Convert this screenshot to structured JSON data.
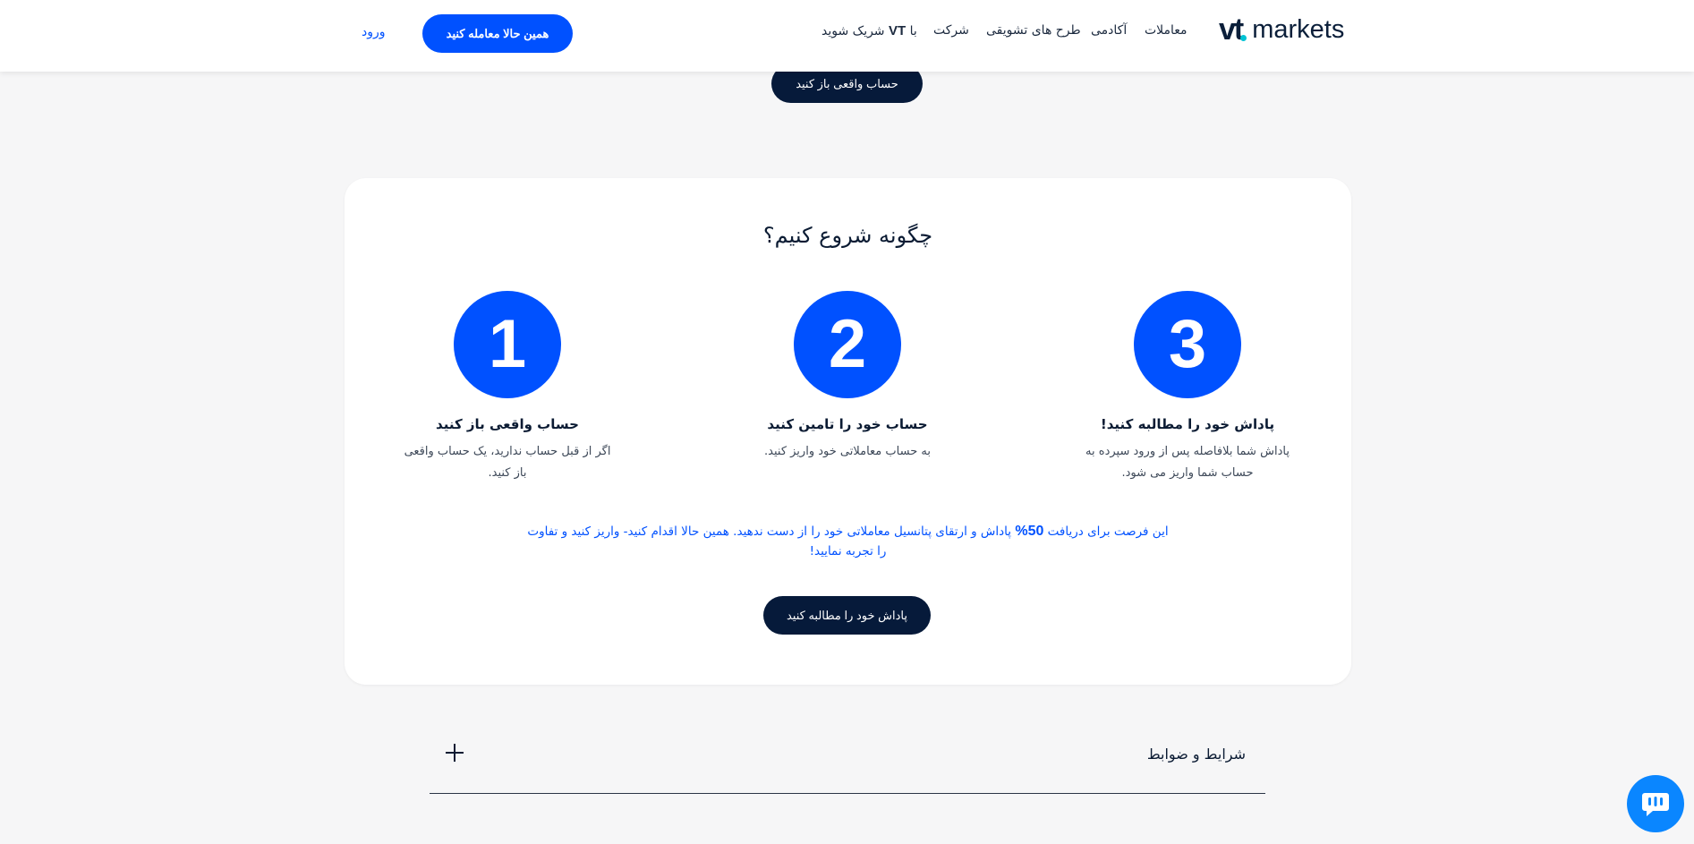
{
  "header": {
    "logo": {
      "mark": "vt",
      "text": "markets"
    },
    "nav": [
      {
        "id": "trading",
        "label": "معاملات"
      },
      {
        "id": "academy",
        "label": "آکادمی"
      },
      {
        "id": "promotions",
        "label": "طرح های تشویقی"
      },
      {
        "id": "company",
        "label": "شرکت"
      },
      {
        "id": "partner",
        "label_prefix": "با",
        "label_brand": "VT",
        "label_suffix": "شریک شوید"
      }
    ],
    "trade_now_label": "همین حالا معامله کنید",
    "login_label": "ورود"
  },
  "top_button_label": "حساب واقعی باز کنید",
  "card": {
    "title": "چگونه شروع کنیم؟",
    "steps": [
      {
        "number": "1",
        "title": "حساب واقعی باز کنید",
        "desc": "اگر از قبل حساب ندارید، یک حساب واقعی باز کنید."
      },
      {
        "number": "2",
        "title": "حساب خود را تامین کنید",
        "desc": "به حساب معاملاتی خود واریز کنید."
      },
      {
        "number": "3",
        "title": "پاداش خود را مطالبه کنید!",
        "desc": "پاداش شما بلافاصله پس از ورود سپرده به حساب شما واریز می شود."
      }
    ],
    "promo_before": "این فرصت برای دریافت",
    "promo_percent": "50%",
    "promo_after": "پاداش و ارتقای پتانسیل معاملاتی خود را از دست ندهید. همین حالا اقدام کنید- واریز کنید و تفاوت را تجربه نمایید!",
    "claim_button_label": "پاداش خود را مطالبه کنید"
  },
  "terms": {
    "label": "شرایط و ضوابط"
  },
  "colors": {
    "accent": "#0051ff",
    "navy": "#061a3a",
    "chat": "#0a86ff",
    "logo_dot": "#00c3d4"
  },
  "icons": {
    "terms_toggle": "plus-icon",
    "chat": "chat-bubble-icon"
  }
}
